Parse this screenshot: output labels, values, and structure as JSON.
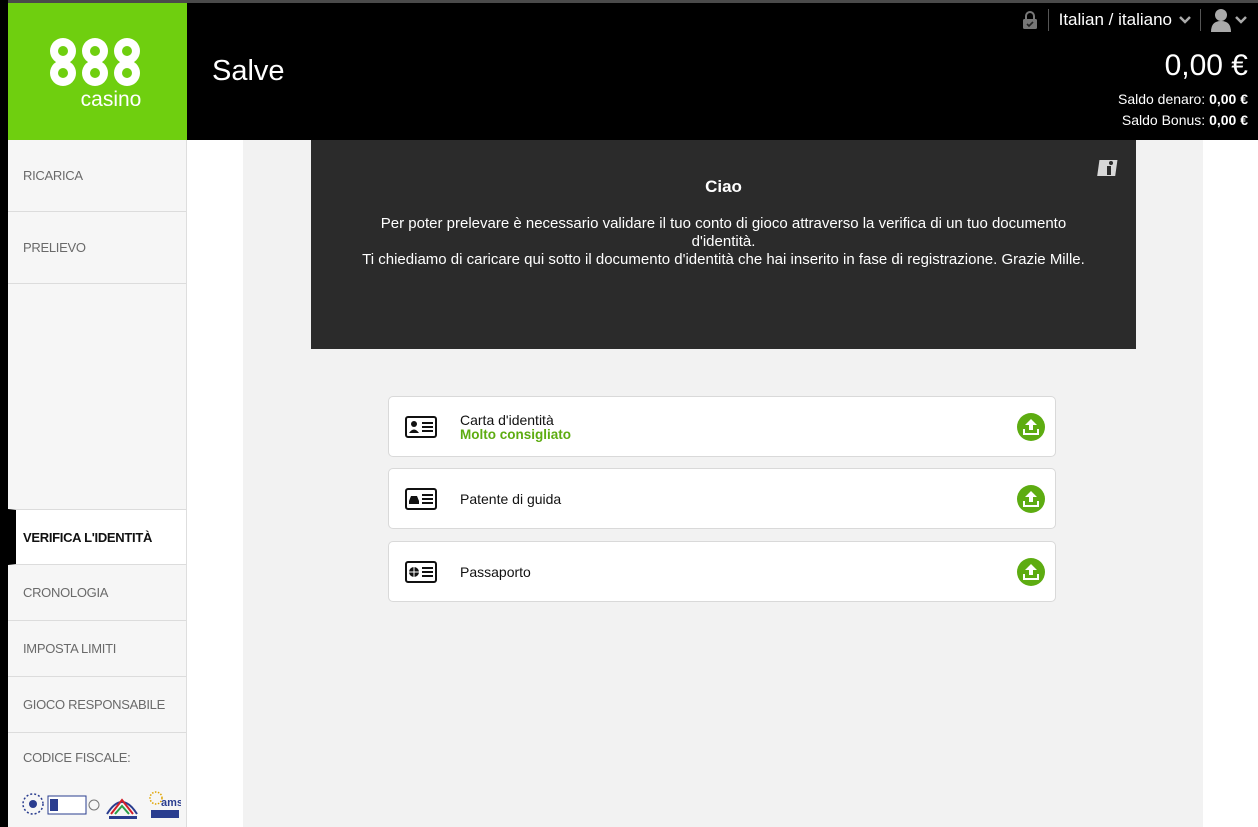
{
  "header": {
    "greeting": "Salve",
    "language": "Italian / italiano",
    "balance_total": "0,00 €",
    "saldo_denaro_label": "Saldo denaro:",
    "saldo_denaro_value": "0,00 €",
    "saldo_bonus_label": "Saldo Bonus:",
    "saldo_bonus_value": "0,00 €"
  },
  "logo": {
    "top": "888",
    "bottom": "casino"
  },
  "sidebar": {
    "items": [
      {
        "label": "RICARICA"
      },
      {
        "label": "PRELIEVO"
      },
      {
        "label": "VERIFICA L'IDENTITÀ"
      },
      {
        "label": "CRONOLOGIA"
      },
      {
        "label": "IMPOSTA LIMITI"
      },
      {
        "label": "GIOCO RESPONSABILE"
      }
    ],
    "codice_fiscale": "CODICE FISCALE:"
  },
  "banner": {
    "title": "Ciao",
    "line1": "Per poter prelevare è necessario validare il tuo conto di gioco attraverso la verifica di un tuo documento d'identità.",
    "line2": "Ti chiediamo di caricare qui sotto il documento d'identità che hai inserito in fase di registrazione. Grazie Mille."
  },
  "documents": [
    {
      "name": "Carta d'identità",
      "sub": "Molto consigliato",
      "icon": "id-card-icon"
    },
    {
      "name": "Patente di guida",
      "sub": "",
      "icon": "driving-license-icon"
    },
    {
      "name": "Passaporto",
      "sub": "",
      "icon": "passport-icon"
    }
  ],
  "colors": {
    "brand_green": "#6fcf0f",
    "accent_green": "#5dac11",
    "banner_bg": "#2b2b2b"
  }
}
